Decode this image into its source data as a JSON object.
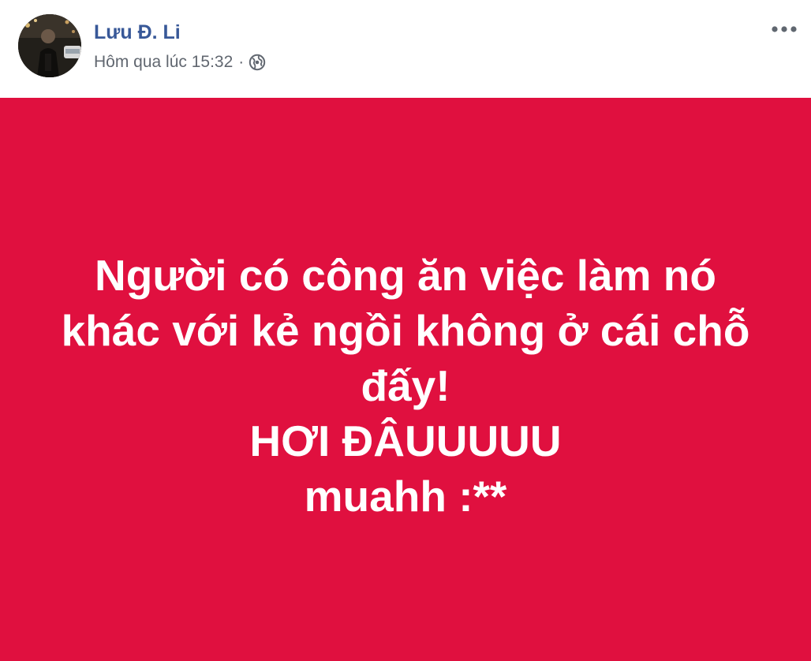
{
  "post": {
    "author_name": "Lưu Đ. Li",
    "timestamp": "Hôm qua lúc 15:32",
    "separator": "·",
    "privacy_icon": "globe-icon",
    "more_icon": "more-horizontal-icon",
    "background_color": "#e0103f",
    "text": "Người có công ăn việc làm nó\nkhác với kẻ ngồi không ở cái chỗ\nđấy!\nHƠI ĐÂUUUUU\nmuahh :**"
  }
}
